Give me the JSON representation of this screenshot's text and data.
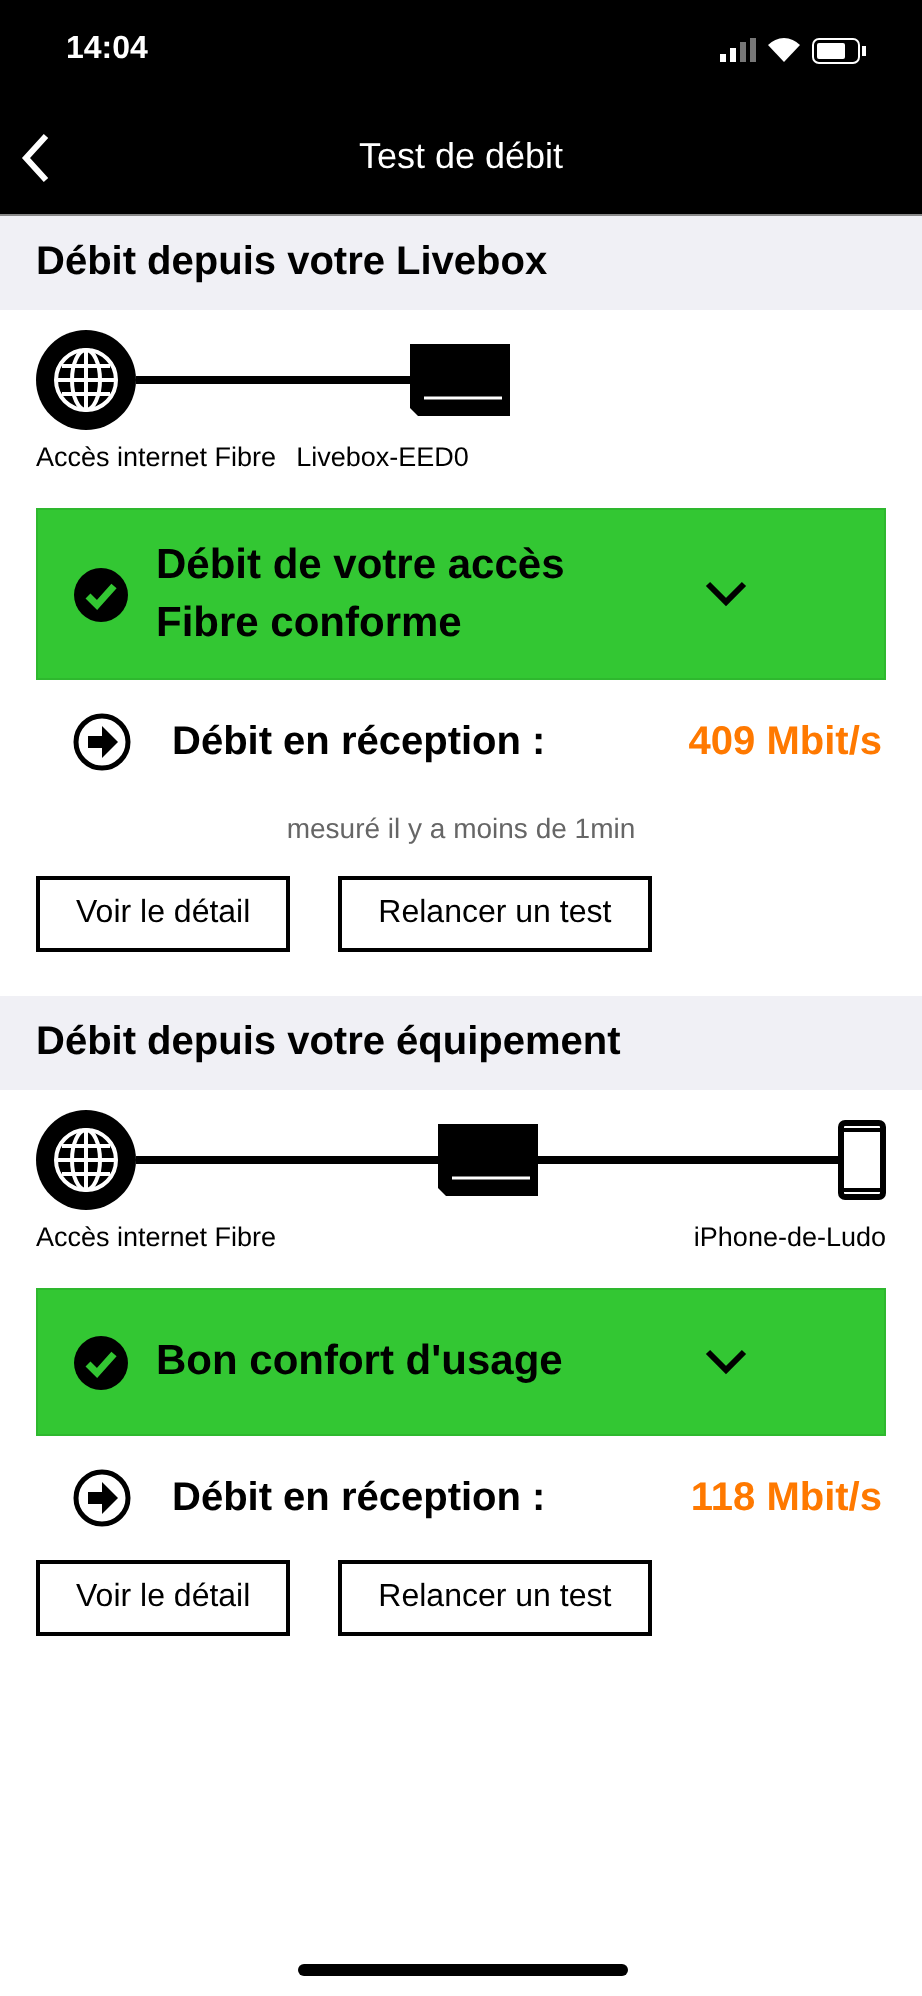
{
  "status_bar": {
    "time": "14:04"
  },
  "nav": {
    "title": "Test de débit"
  },
  "sections": [
    {
      "title": "Débit depuis votre Livebox",
      "nodes": [
        {
          "kind": "globe"
        },
        {
          "kind": "box"
        }
      ],
      "labels": [
        "Accès internet Fibre",
        "Livebox-EED0"
      ],
      "status": {
        "text": "Débit de votre accès Fibre conforme",
        "expanded": false
      },
      "reading": {
        "label": "Débit en réception :",
        "value": "409 Mbit/s"
      },
      "note": "mesuré il y a moins de 1min",
      "buttons": [
        "Voir le détail",
        "Relancer un test"
      ]
    },
    {
      "title": "Débit depuis votre équipement",
      "nodes": [
        {
          "kind": "globe"
        },
        {
          "kind": "box"
        },
        {
          "kind": "phone"
        }
      ],
      "labels": [
        "Accès internet Fibre",
        "iPhone-de-Ludo"
      ],
      "status": {
        "text": "Bon confort d'usage",
        "expanded": false
      },
      "reading": {
        "label": "Débit en réception :",
        "value": "118 Mbit/s"
      },
      "buttons": [
        "Voir le détail",
        "Relancer un test"
      ]
    }
  ]
}
